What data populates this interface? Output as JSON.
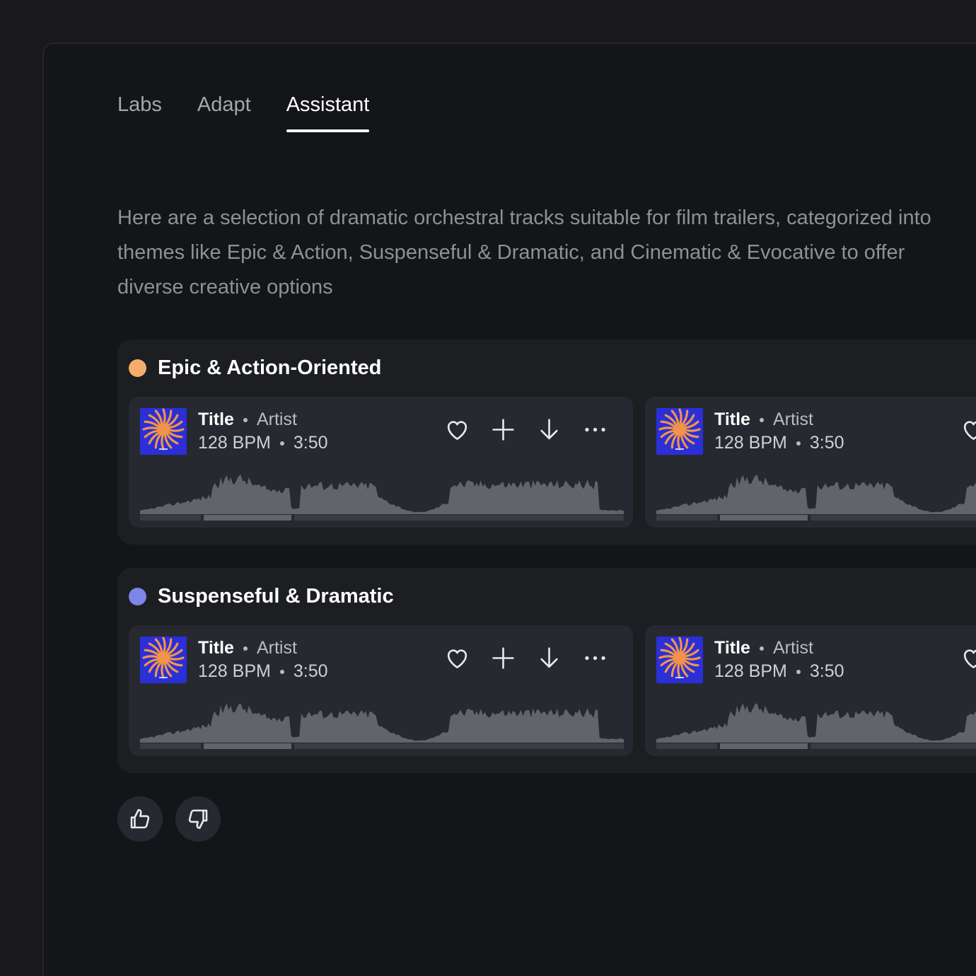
{
  "tabs": [
    {
      "label": "Labs",
      "active": false
    },
    {
      "label": "Adapt",
      "active": false
    },
    {
      "label": "Assistant",
      "active": true
    }
  ],
  "intro": "Here are a selection of dramatic orchestral tracks suitable for film trailers, categorized into themes like Epic & Action, Suspenseful & Dramatic, and Cinematic & Evocative to offer diverse creative options",
  "groups": [
    {
      "title": "Epic & Action-Oriented",
      "dot_color": "#f6ad6b",
      "tracks": [
        {
          "title": "Title",
          "artist": "Artist",
          "bpm": "128 BPM",
          "duration": "3:50"
        },
        {
          "title": "Title",
          "artist": "Artist",
          "bpm": "128 BPM",
          "duration": "3:50"
        }
      ]
    },
    {
      "title": "Suspenseful & Dramatic",
      "dot_color": "#7b86e8",
      "tracks": [
        {
          "title": "Title",
          "artist": "Artist",
          "bpm": "128 BPM",
          "duration": "3:50"
        },
        {
          "title": "Title",
          "artist": "Artist",
          "bpm": "128 BPM",
          "duration": "3:50"
        }
      ]
    }
  ],
  "icons": {
    "like": "heart-icon",
    "add": "plus-icon",
    "download": "download-icon",
    "more": "more-icon",
    "thumbs_up": "thumbs-up-icon",
    "thumbs_down": "thumbs-down-icon"
  },
  "colors": {
    "background": "#141518",
    "card": "#272930",
    "group": "#1c1e22",
    "art_blue": "#2b2fd8",
    "art_orange": "#f0944a"
  }
}
